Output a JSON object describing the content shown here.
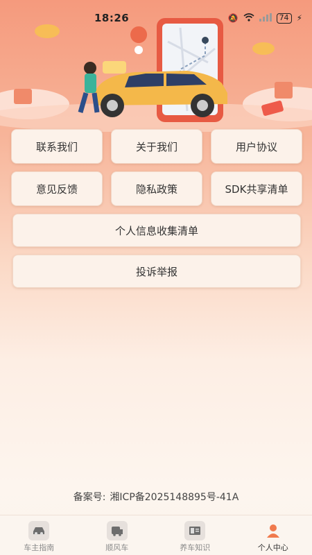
{
  "status": {
    "time": "18:26",
    "battery": "74"
  },
  "grid": {
    "row1": [
      "联系我们",
      "关于我们",
      "用户协议"
    ],
    "row2": [
      "意见反馈",
      "隐私政策",
      "SDK共享清单"
    ],
    "full1": "个人信息收集清单",
    "full2": "投诉举报"
  },
  "icp": {
    "label": "备案号:",
    "value": "湘ICP备2025148895号-41A"
  },
  "tabs": [
    {
      "label": "车主指南",
      "icon": "car-icon"
    },
    {
      "label": "顺风车",
      "icon": "carpool-icon"
    },
    {
      "label": "养车知识",
      "icon": "book-icon"
    },
    {
      "label": "个人中心",
      "icon": "user-icon"
    }
  ],
  "colors": {
    "accent": "#f07a4d",
    "car": "#f4b84a",
    "background_top": "#f59a7d"
  }
}
